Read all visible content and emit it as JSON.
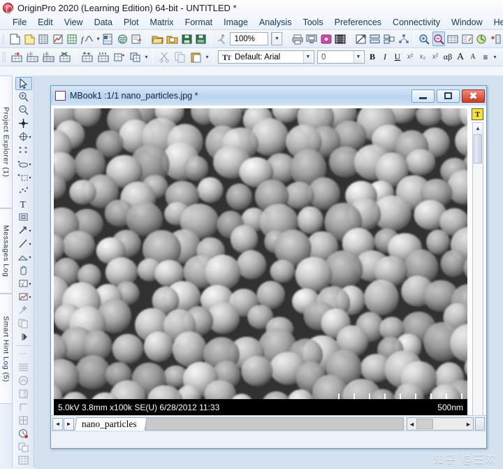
{
  "window": {
    "app_title": "OriginPro 2020 (Learning Edition) 64-bit - UNTITLED *",
    "logo_icon": "origin-logo-icon"
  },
  "menubar": {
    "items": [
      {
        "label": "File"
      },
      {
        "label": "Edit"
      },
      {
        "label": "View"
      },
      {
        "label": "Data"
      },
      {
        "label": "Plot"
      },
      {
        "label": "Matrix"
      },
      {
        "label": "Format"
      },
      {
        "label": "Image"
      },
      {
        "label": "Analysis"
      },
      {
        "label": "Tools"
      },
      {
        "label": "Preferences"
      },
      {
        "label": "Connectivity"
      },
      {
        "label": "Window"
      },
      {
        "label": "Help"
      }
    ]
  },
  "toolbar_standard": {
    "zoom_value": "100%",
    "icons": [
      "new-project-icon",
      "open-project-icon",
      "new-workbook-icon",
      "new-graph-icon",
      "new-matrix-icon",
      "new-function-plot-icon",
      "open-excel-icon",
      "import-single-ascii-icon",
      "import-wizard-icon",
      "open-folder-icon",
      "open-template-icon",
      "save-project-icon",
      "save-template-icon",
      "run-script-icon"
    ],
    "icons_right": [
      "print-icon",
      "print-preview-icon",
      "copy-page-icon",
      "movie-icon",
      "layer-management-icon",
      "arrange-layers-icon",
      "merge-graph-icon",
      "hierarchy-icon",
      "zoom-in-icon",
      "zoom-out-icon",
      "worksheet-icon",
      "report-icon",
      "refresh-icon",
      "add-column-icon"
    ]
  },
  "toolbar_worksheet": {
    "icons": [
      "add-new-columns-icon",
      "set-column-values-icon",
      "normalize-columns-icon",
      "transpose-icon",
      "sort-worksheet-icon",
      "sort-columns-icon",
      "insert-rows-icon",
      "stack-columns-icon"
    ],
    "edit_icons": [
      "cut-icon",
      "copy-icon",
      "paste-icon"
    ]
  },
  "toolbar_format": {
    "font_label": "Default: Arial",
    "font_size": "0",
    "style_buttons": [
      {
        "name": "bold-button",
        "label": "B"
      },
      {
        "name": "italic-button",
        "label": "I"
      },
      {
        "name": "underline-button",
        "label": "U"
      },
      {
        "name": "superscript-button",
        "label": "x²"
      },
      {
        "name": "subscript-button",
        "label": "x₂"
      },
      {
        "name": "superscript-subscript-button",
        "label": "x²"
      },
      {
        "name": "greek-button",
        "label": "αβ"
      },
      {
        "name": "increase-font-button",
        "label": "A"
      },
      {
        "name": "decrease-font-button",
        "label": "A"
      },
      {
        "name": "align-button",
        "label": "≡"
      }
    ]
  },
  "left_dock": {
    "tabs": [
      {
        "label": "Project Explorer (1)",
        "name": "dock-tab-project-explorer"
      },
      {
        "label": "Messages Log",
        "name": "dock-tab-messages-log"
      },
      {
        "label": "Smart Hint Log (5)",
        "name": "dock-tab-smart-hint-log"
      }
    ]
  },
  "tool_palette": {
    "tools": [
      {
        "name": "pointer-tool",
        "selected": true
      },
      {
        "name": "zoom-in-tool",
        "selected": false
      },
      {
        "name": "zoom-out-tool",
        "selected": false
      },
      {
        "name": "data-reader-tool",
        "selected": false
      },
      {
        "name": "screen-reader-tool",
        "selected": false
      },
      {
        "name": "data-selector-tool",
        "selected": false
      },
      {
        "name": "regional-mask-tool",
        "selected": false
      },
      {
        "name": "regional-data-selector-tool",
        "selected": false
      },
      {
        "name": "draw-data-tool",
        "selected": false
      },
      {
        "name": "text-tool",
        "selected": false
      },
      {
        "name": "object-edit-tool",
        "selected": false
      },
      {
        "name": "arrow-tool",
        "selected": false
      },
      {
        "name": "line-tool",
        "selected": false
      },
      {
        "name": "polyline-tool",
        "selected": false
      },
      {
        "name": "pan-tool",
        "selected": false
      },
      {
        "name": "region-math-tool",
        "selected": false
      },
      {
        "name": "rescale-tool",
        "selected": false
      },
      {
        "name": "magic-wand-tool",
        "selected": false
      },
      {
        "name": "copy-page-tool",
        "selected": false
      },
      {
        "name": "expand-palette-tool",
        "selected": false
      },
      {
        "name": "dotted-rect-tool",
        "selected": false
      },
      {
        "name": "lines-tool",
        "selected": false
      },
      {
        "name": "circle-tool",
        "selected": false
      },
      {
        "name": "scale-bar-tool",
        "selected": false
      },
      {
        "name": "rectangle-tool",
        "selected": false
      },
      {
        "name": "table-tool",
        "selected": false
      },
      {
        "name": "clock-tool",
        "selected": false
      },
      {
        "name": "layout-tool",
        "selected": false
      },
      {
        "name": "grid-tool",
        "selected": false
      }
    ]
  },
  "child_window": {
    "title": "MBook1 :1/1 nano_particles.jpg *",
    "icon": "matrix-book-icon",
    "minimize_label": "minimize",
    "maximize_label": "maximize",
    "close_label": "close",
    "text_badge": "T",
    "sheet_tab": "nano_particles",
    "nav_prev": "◄",
    "nav_next": "►"
  },
  "sem_image": {
    "caption_left": "5.0kV 3.8mm x100k SE(U) 6/28/2012 11:33",
    "caption_right": "500nm",
    "subject": "densely packed spherical nanoparticles"
  },
  "watermark": {
    "text": "知乎 @王欢"
  },
  "colors": {
    "accent_blue": "#6d9cc9",
    "titlebar_blue": "#b9d4ee",
    "close_red": "#cf3a24",
    "badge_yellow": "#f2e23a",
    "mdi_background": "#d4e1ef"
  }
}
